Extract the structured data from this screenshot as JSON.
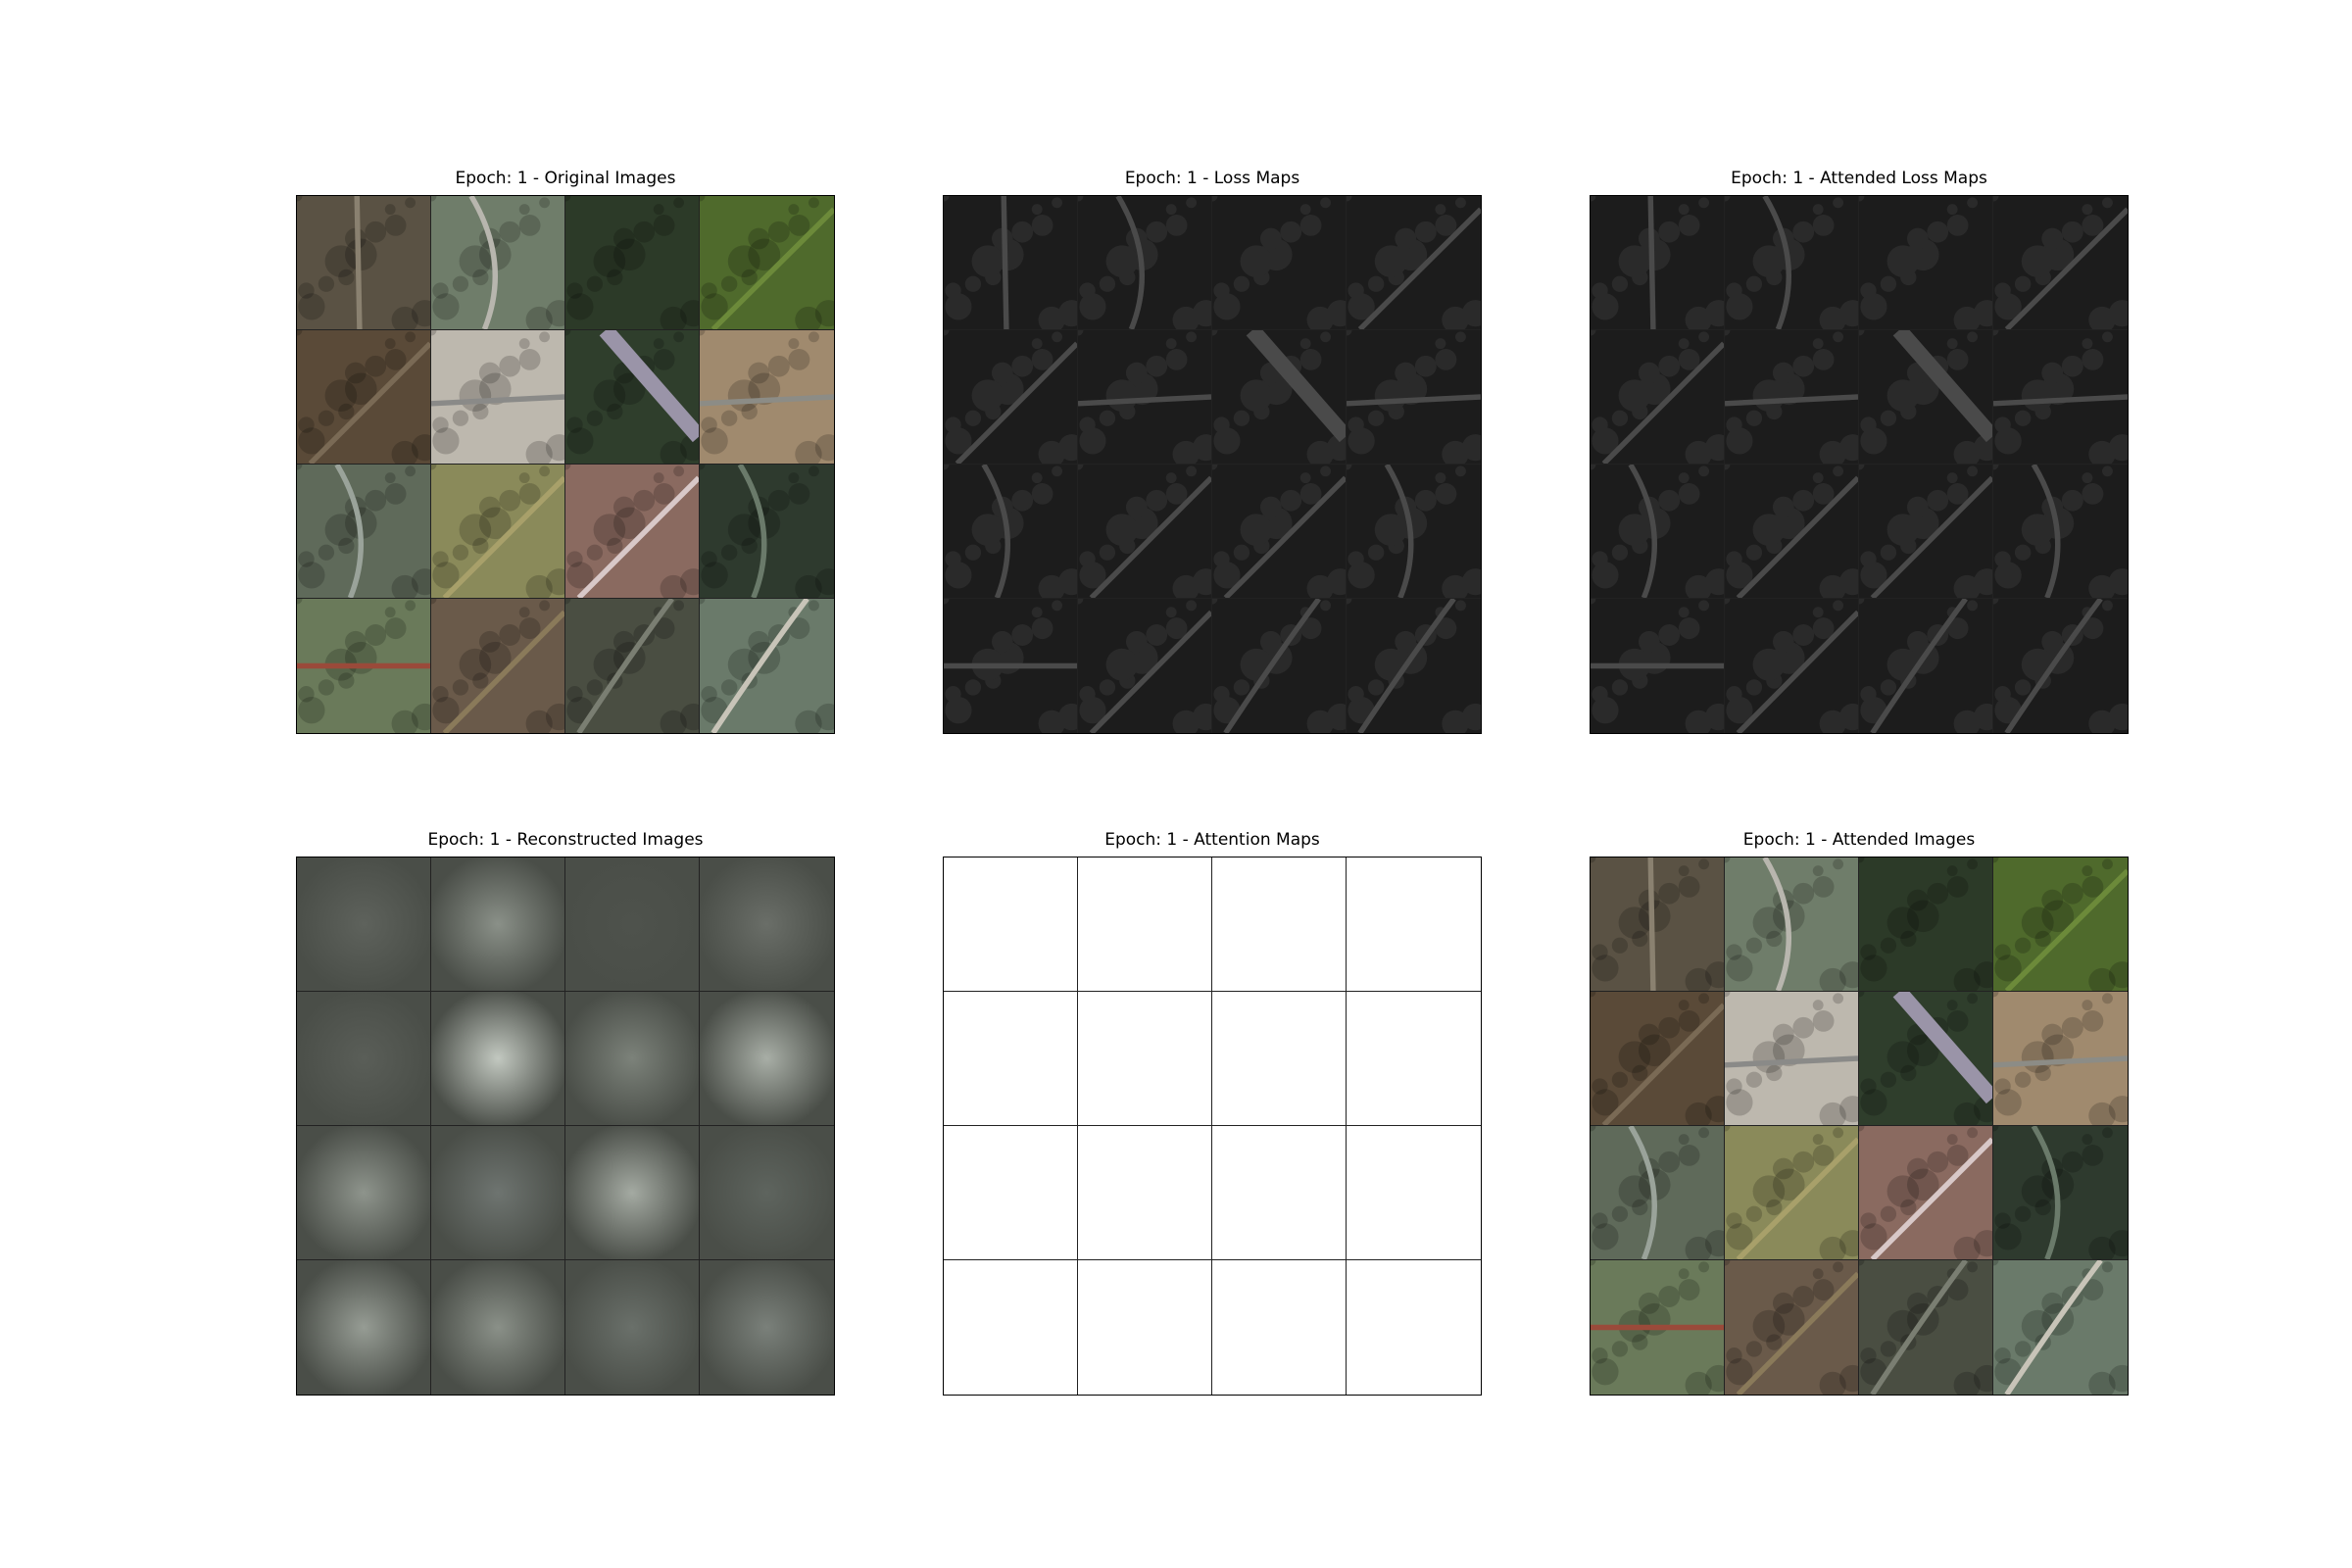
{
  "panels": [
    {
      "id": "orig",
      "title": "Epoch: 1 - Original Images",
      "kind": "aerial"
    },
    {
      "id": "loss",
      "title": "Epoch: 1 - Loss Maps",
      "kind": "loss"
    },
    {
      "id": "attloss",
      "title": "Epoch: 1 - Attended Loss Maps",
      "kind": "loss"
    },
    {
      "id": "recon",
      "title": "Epoch: 1 - Reconstructed Images",
      "kind": "recon"
    },
    {
      "id": "attn",
      "title": "Epoch: 1 - Attention Maps",
      "kind": "blank"
    },
    {
      "id": "atimg",
      "title": "Epoch: 1 - Attended Images",
      "kind": "aerial"
    }
  ],
  "grid": {
    "rows": 4,
    "cols": 4
  },
  "aerial_tiles": [
    {
      "bg": "#5a5244",
      "accent": "#8a8170",
      "feature": "road-vertical"
    },
    {
      "bg": "#6f7d6a",
      "accent": "#b8b6ae",
      "feature": "road-curve"
    },
    {
      "bg": "#2c3a28",
      "accent": "#4b5a3a",
      "feature": "forest"
    },
    {
      "bg": "#4f6a2c",
      "accent": "#6c8a3a",
      "feature": "road-diagonal"
    },
    {
      "bg": "#5a4a38",
      "accent": "#7a6a55",
      "feature": "road-diagonal"
    },
    {
      "bg": "#bdb8ae",
      "accent": "#8a8a88",
      "feature": "road-horizontal"
    },
    {
      "bg": "#2f3e2c",
      "accent": "#9a94a8",
      "feature": "highway-diagonal"
    },
    {
      "bg": "#a08a6e",
      "accent": "#8c8c86",
      "feature": "road-horizontal"
    },
    {
      "bg": "#5f6a5a",
      "accent": "#9aa39a",
      "feature": "road-curve"
    },
    {
      "bg": "#8a8a5a",
      "accent": "#a8a06a",
      "feature": "road-diagonal"
    },
    {
      "bg": "#8a6a60",
      "accent": "#d8c8c8",
      "feature": "road-diagonal"
    },
    {
      "bg": "#2e3a2e",
      "accent": "#6a7a6a",
      "feature": "road-curve"
    },
    {
      "bg": "#6a7a5a",
      "accent": "#9a4a3a",
      "feature": "field-road"
    },
    {
      "bg": "#6a5a4a",
      "accent": "#8a7a5a",
      "feature": "road-diagonal"
    },
    {
      "bg": "#4a4e42",
      "accent": "#7a7e72",
      "feature": "buildings"
    },
    {
      "bg": "#6a7a6a",
      "accent": "#c8c4b8",
      "feature": "buildings"
    }
  ],
  "recon_tiles": [
    {
      "tone": "#5e625c"
    },
    {
      "tone": "#8a9088"
    },
    {
      "tone": "#4e524c"
    },
    {
      "tone": "#6a6e68"
    },
    {
      "tone": "#5a5e58"
    },
    {
      "tone": "#c2c8c0"
    },
    {
      "tone": "#7c827a"
    },
    {
      "tone": "#a8aea6"
    },
    {
      "tone": "#8e948c"
    },
    {
      "tone": "#6e7470"
    },
    {
      "tone": "#a4aaa2"
    },
    {
      "tone": "#5e645e"
    },
    {
      "tone": "#969c94"
    },
    {
      "tone": "#8a9088"
    },
    {
      "tone": "#6a706a"
    },
    {
      "tone": "#7a807a"
    }
  ]
}
